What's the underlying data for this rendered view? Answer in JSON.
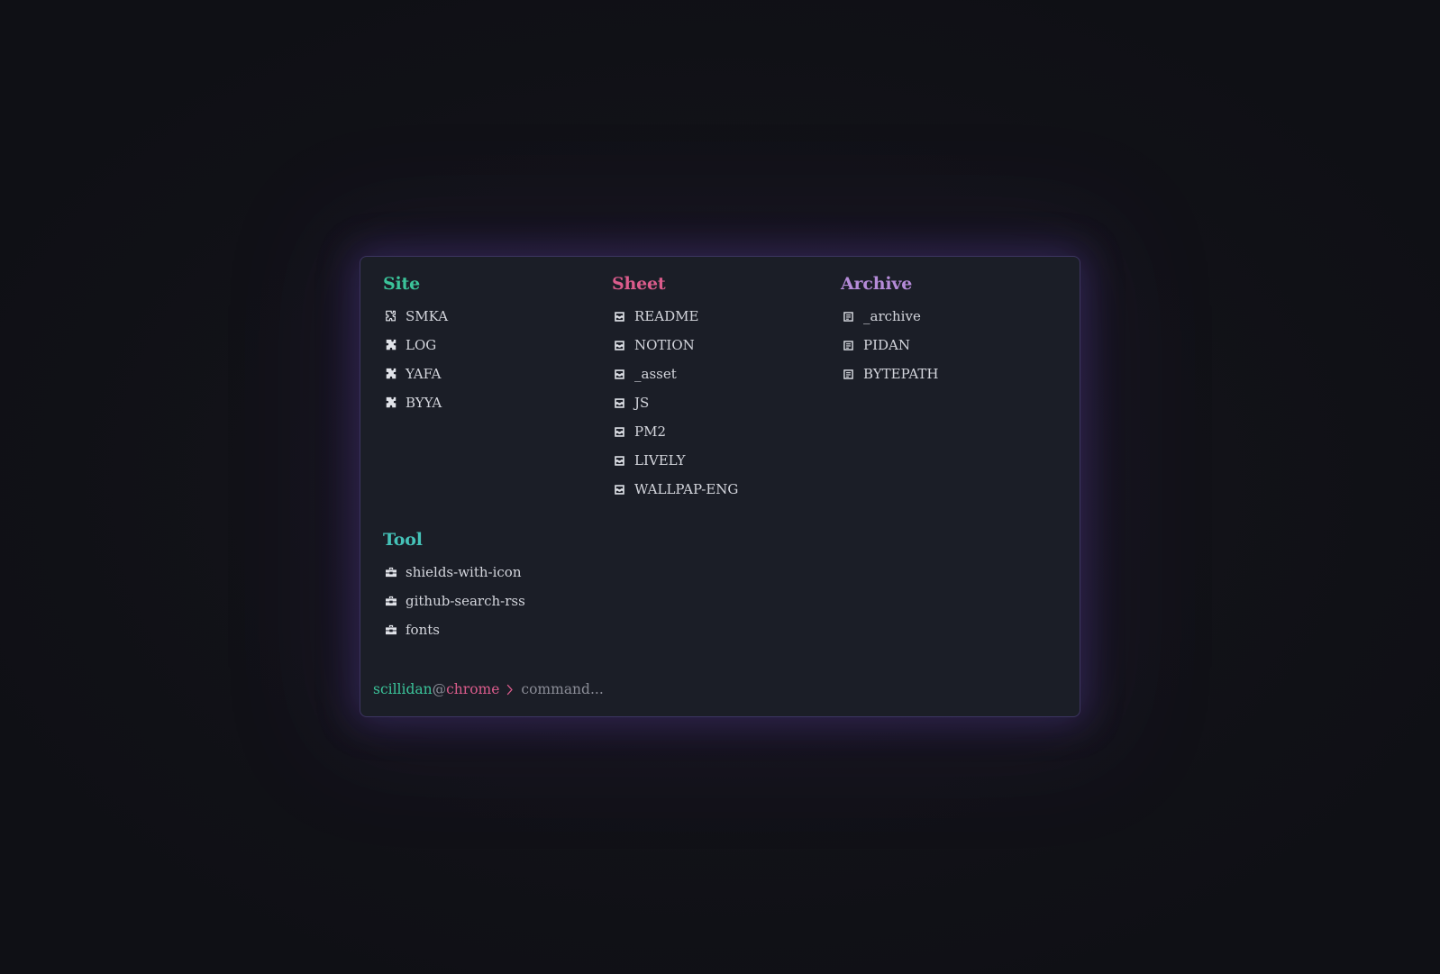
{
  "colors": {
    "site": "#3bc49a",
    "sheet": "#db5c8c",
    "archive": "#b58bd8",
    "tool": "#45c2b8",
    "user": "#3bc49a",
    "host": "#db5c8c",
    "at": "#8a8c96",
    "chevron": "#db5c8c"
  },
  "groups": {
    "site": {
      "title": "Site",
      "items": [
        {
          "label": "SMKA",
          "icon": "puzzle-outline-icon"
        },
        {
          "label": "LOG",
          "icon": "puzzle-icon"
        },
        {
          "label": "YAFA",
          "icon": "puzzle-icon"
        },
        {
          "label": "BYYA",
          "icon": "puzzle-icon"
        }
      ]
    },
    "sheet": {
      "title": "Sheet",
      "items": [
        {
          "label": "README",
          "icon": "inbox-tray-icon"
        },
        {
          "label": "NOTION",
          "icon": "inbox-tray-icon"
        },
        {
          "label": "_asset",
          "icon": "inbox-tray-icon"
        },
        {
          "label": "JS",
          "icon": "inbox-tray-icon"
        },
        {
          "label": "PM2",
          "icon": "inbox-tray-icon"
        },
        {
          "label": "LIVELY",
          "icon": "inbox-tray-icon"
        },
        {
          "label": "WALLPAP-ENG",
          "icon": "inbox-tray-icon"
        }
      ]
    },
    "archive": {
      "title": "Archive",
      "items": [
        {
          "label": "_archive",
          "icon": "note-icon"
        },
        {
          "label": "PIDAN",
          "icon": "note-icon"
        },
        {
          "label": "BYTEPATH",
          "icon": "note-icon"
        }
      ]
    },
    "tool": {
      "title": "Tool",
      "items": [
        {
          "label": "shields-with-icon",
          "icon": "toolbox-icon"
        },
        {
          "label": "github-search-rss",
          "icon": "toolbox-icon"
        },
        {
          "label": "fonts",
          "icon": "toolbox-icon"
        }
      ]
    }
  },
  "prompt": {
    "user": "scillidan",
    "at": "@",
    "host": "chrome",
    "placeholder": "command...",
    "value": ""
  }
}
